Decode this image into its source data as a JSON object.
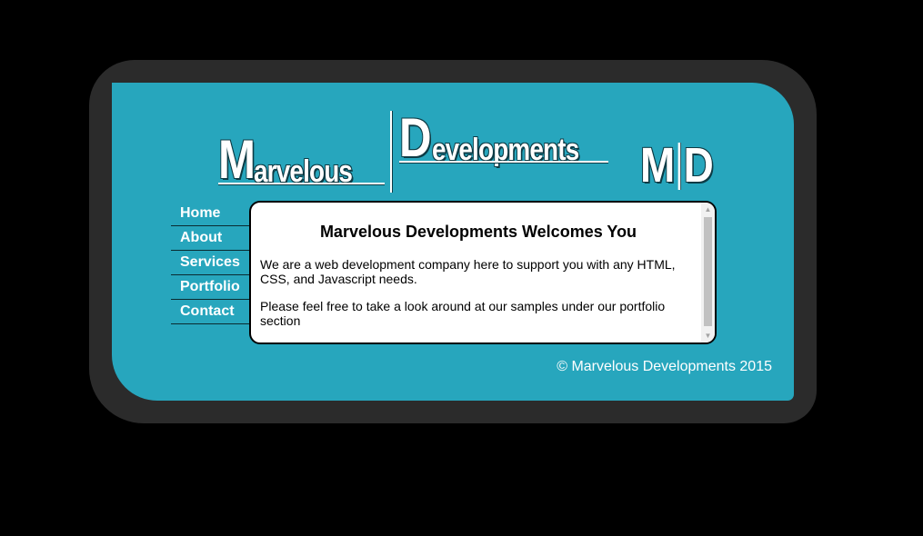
{
  "logo": {
    "word1_initial": "M",
    "word1_rest": "arvelous",
    "word2_initial": "D",
    "word2_rest": "evelopments",
    "monogram_left": "M",
    "monogram_right": "D"
  },
  "nav": {
    "items": [
      {
        "label": "Home"
      },
      {
        "label": "About"
      },
      {
        "label": "Services"
      },
      {
        "label": "Portfolio"
      },
      {
        "label": "Contact"
      }
    ]
  },
  "content": {
    "title": "Marvelous Developments Welcomes You",
    "paragraph1": "We are a web development company here to support you with any HTML, CSS, and Javascript needs.",
    "paragraph2": "Please feel free to take a look around at our samples under our portfolio section"
  },
  "footer": {
    "copyright": "© Marvelous Developments 2015"
  },
  "colors": {
    "page_background": "#000000",
    "frame": "#2b2b2b",
    "panel": "#27a6bd",
    "logo_outline": "#0d3b45",
    "text_light": "#ffffff"
  },
  "icons": {
    "scroll_up": "triangle-up",
    "scroll_down": "triangle-down"
  }
}
